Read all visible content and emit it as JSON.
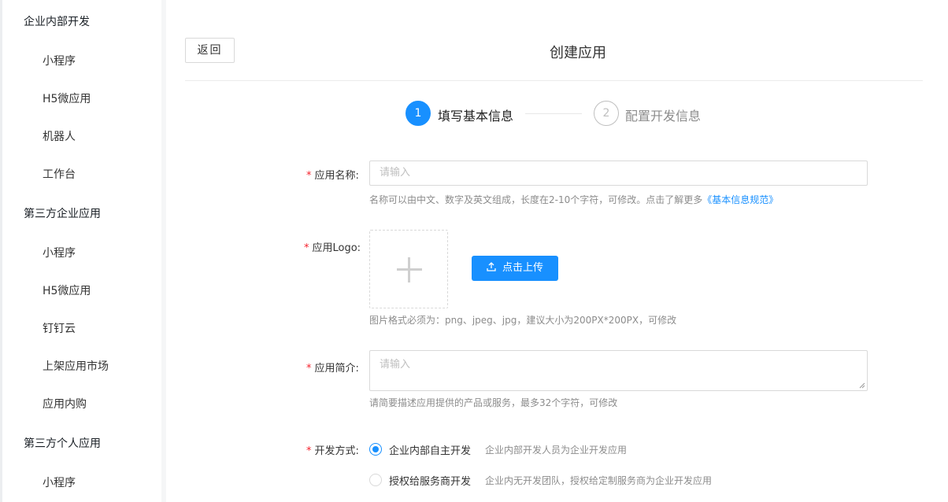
{
  "sidebar": {
    "groups": [
      {
        "title": "企业内部开发",
        "items": [
          "小程序",
          "H5微应用",
          "机器人",
          "工作台"
        ]
      },
      {
        "title": "第三方企业应用",
        "items": [
          "小程序",
          "H5微应用",
          "钉钉云",
          "上架应用市场",
          "应用内购"
        ]
      },
      {
        "title": "第三方个人应用",
        "items": [
          "小程序"
        ]
      }
    ]
  },
  "header": {
    "back_label": "返回",
    "title": "创建应用"
  },
  "steps": [
    {
      "number": "1",
      "label": "填写基本信息",
      "active": true
    },
    {
      "number": "2",
      "label": "配置开发信息",
      "active": false
    }
  ],
  "form": {
    "required_mark": "*",
    "name": {
      "label": "应用名称:",
      "placeholder": "请输入",
      "hint": "名称可以由中文、数字及英文组成，长度在2-10个字符，可修改。点击了解更多",
      "hint_link": "《基本信息规范》"
    },
    "logo": {
      "label": "应用Logo:",
      "upload_label": "点击上传",
      "hint": "图片格式必须为：png、jpeg、jpg，建议大小为200PX*200PX，可修改"
    },
    "intro": {
      "label": "应用简介:",
      "placeholder": "请输入",
      "hint": "请简要描述应用提供的产品或服务，最多32个字符，可修改"
    },
    "dev_mode": {
      "label": "开发方式:",
      "options": [
        {
          "label": "企业内部自主开发",
          "desc": "企业内部开发人员为企业开发应用",
          "checked": true
        },
        {
          "label": "授权给服务商开发",
          "desc": "企业内无开发团队，授权给定制服务商为企业开发应用",
          "checked": false
        }
      ]
    }
  },
  "colors": {
    "primary": "#1890ff",
    "required": "#f5222d"
  }
}
